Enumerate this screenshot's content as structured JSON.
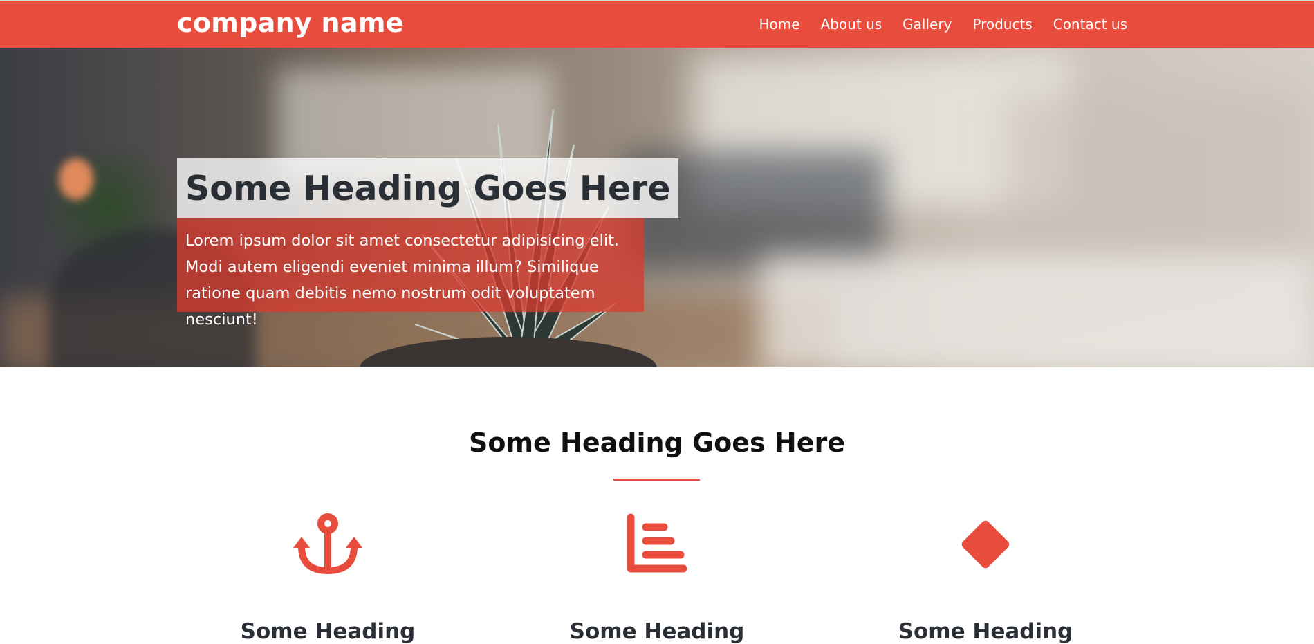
{
  "colors": {
    "accent": "#e74c3c",
    "hero_text_box": "#d73c30",
    "heading_text": "#2a2e35",
    "white": "#ffffff"
  },
  "navbar": {
    "brand": "company name",
    "links": [
      {
        "label": "Home"
      },
      {
        "label": "About us"
      },
      {
        "label": "Gallery"
      },
      {
        "label": "Products"
      },
      {
        "label": "Contact us"
      }
    ]
  },
  "hero": {
    "heading": "Some Heading Goes Here",
    "text": "Lorem ipsum dolor sit amet consectetur adipisicing elit. Modi autem eligendi eveniet minima illum? Similique ratione quam debitis nemo nostrum odit voluptatem nesciunt!"
  },
  "section": {
    "title": "Some Heading Goes Here",
    "features": [
      {
        "icon": "anchor-icon",
        "title": "Some Heading"
      },
      {
        "icon": "bar-chart-icon",
        "title": "Some Heading"
      },
      {
        "icon": "diamond-icon",
        "title": "Some Heading"
      }
    ]
  }
}
